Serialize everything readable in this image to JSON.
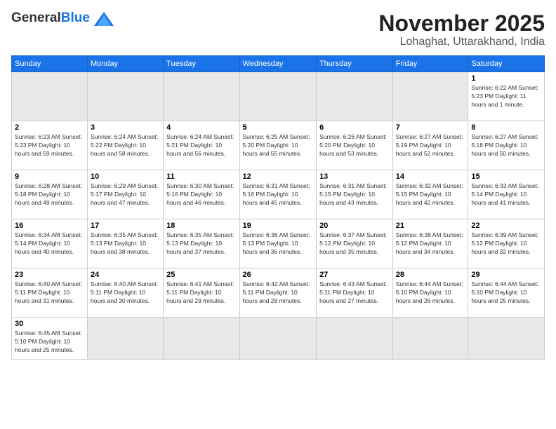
{
  "header": {
    "logo_general": "General",
    "logo_blue": "Blue",
    "month_title": "November 2025",
    "location": "Lohaghat, Uttarakhand, India"
  },
  "days_of_week": [
    "Sunday",
    "Monday",
    "Tuesday",
    "Wednesday",
    "Thursday",
    "Friday",
    "Saturday"
  ],
  "weeks": [
    [
      {
        "num": "",
        "info": ""
      },
      {
        "num": "",
        "info": ""
      },
      {
        "num": "",
        "info": ""
      },
      {
        "num": "",
        "info": ""
      },
      {
        "num": "",
        "info": ""
      },
      {
        "num": "",
        "info": ""
      },
      {
        "num": "1",
        "info": "Sunrise: 6:22 AM\nSunset: 5:23 PM\nDaylight: 11 hours and 1 minute."
      }
    ],
    [
      {
        "num": "2",
        "info": "Sunrise: 6:23 AM\nSunset: 5:23 PM\nDaylight: 10 hours and 59 minutes."
      },
      {
        "num": "3",
        "info": "Sunrise: 6:24 AM\nSunset: 5:22 PM\nDaylight: 10 hours and 58 minutes."
      },
      {
        "num": "4",
        "info": "Sunrise: 6:24 AM\nSunset: 5:21 PM\nDaylight: 10 hours and 56 minutes."
      },
      {
        "num": "5",
        "info": "Sunrise: 6:25 AM\nSunset: 5:20 PM\nDaylight: 10 hours and 55 minutes."
      },
      {
        "num": "6",
        "info": "Sunrise: 6:26 AM\nSunset: 5:20 PM\nDaylight: 10 hours and 53 minutes."
      },
      {
        "num": "7",
        "info": "Sunrise: 6:27 AM\nSunset: 5:19 PM\nDaylight: 10 hours and 52 minutes."
      },
      {
        "num": "8",
        "info": "Sunrise: 6:27 AM\nSunset: 5:18 PM\nDaylight: 10 hours and 50 minutes."
      }
    ],
    [
      {
        "num": "9",
        "info": "Sunrise: 6:28 AM\nSunset: 5:18 PM\nDaylight: 10 hours and 49 minutes."
      },
      {
        "num": "10",
        "info": "Sunrise: 6:29 AM\nSunset: 5:17 PM\nDaylight: 10 hours and 47 minutes."
      },
      {
        "num": "11",
        "info": "Sunrise: 6:30 AM\nSunset: 5:16 PM\nDaylight: 10 hours and 46 minutes."
      },
      {
        "num": "12",
        "info": "Sunrise: 6:31 AM\nSunset: 5:16 PM\nDaylight: 10 hours and 45 minutes."
      },
      {
        "num": "13",
        "info": "Sunrise: 6:31 AM\nSunset: 5:15 PM\nDaylight: 10 hours and 43 minutes."
      },
      {
        "num": "14",
        "info": "Sunrise: 6:32 AM\nSunset: 5:15 PM\nDaylight: 10 hours and 42 minutes."
      },
      {
        "num": "15",
        "info": "Sunrise: 6:33 AM\nSunset: 5:14 PM\nDaylight: 10 hours and 41 minutes."
      }
    ],
    [
      {
        "num": "16",
        "info": "Sunrise: 6:34 AM\nSunset: 5:14 PM\nDaylight: 10 hours and 40 minutes."
      },
      {
        "num": "17",
        "info": "Sunrise: 6:35 AM\nSunset: 5:13 PM\nDaylight: 10 hours and 38 minutes."
      },
      {
        "num": "18",
        "info": "Sunrise: 6:35 AM\nSunset: 5:13 PM\nDaylight: 10 hours and 37 minutes."
      },
      {
        "num": "19",
        "info": "Sunrise: 6:36 AM\nSunset: 5:13 PM\nDaylight: 10 hours and 36 minutes."
      },
      {
        "num": "20",
        "info": "Sunrise: 6:37 AM\nSunset: 5:12 PM\nDaylight: 10 hours and 35 minutes."
      },
      {
        "num": "21",
        "info": "Sunrise: 6:38 AM\nSunset: 5:12 PM\nDaylight: 10 hours and 34 minutes."
      },
      {
        "num": "22",
        "info": "Sunrise: 6:39 AM\nSunset: 5:12 PM\nDaylight: 10 hours and 32 minutes."
      }
    ],
    [
      {
        "num": "23",
        "info": "Sunrise: 6:40 AM\nSunset: 5:11 PM\nDaylight: 10 hours and 31 minutes."
      },
      {
        "num": "24",
        "info": "Sunrise: 6:40 AM\nSunset: 5:11 PM\nDaylight: 10 hours and 30 minutes."
      },
      {
        "num": "25",
        "info": "Sunrise: 6:41 AM\nSunset: 5:11 PM\nDaylight: 10 hours and 29 minutes."
      },
      {
        "num": "26",
        "info": "Sunrise: 6:42 AM\nSunset: 5:11 PM\nDaylight: 10 hours and 28 minutes."
      },
      {
        "num": "27",
        "info": "Sunrise: 6:43 AM\nSunset: 5:11 PM\nDaylight: 10 hours and 27 minutes."
      },
      {
        "num": "28",
        "info": "Sunrise: 6:44 AM\nSunset: 5:10 PM\nDaylight: 10 hours and 26 minutes."
      },
      {
        "num": "29",
        "info": "Sunrise: 6:44 AM\nSunset: 5:10 PM\nDaylight: 10 hours and 25 minutes."
      }
    ],
    [
      {
        "num": "30",
        "info": "Sunrise: 6:45 AM\nSunset: 5:10 PM\nDaylight: 10 hours and 25 minutes."
      },
      {
        "num": "",
        "info": ""
      },
      {
        "num": "",
        "info": ""
      },
      {
        "num": "",
        "info": ""
      },
      {
        "num": "",
        "info": ""
      },
      {
        "num": "",
        "info": ""
      },
      {
        "num": "",
        "info": ""
      }
    ]
  ]
}
